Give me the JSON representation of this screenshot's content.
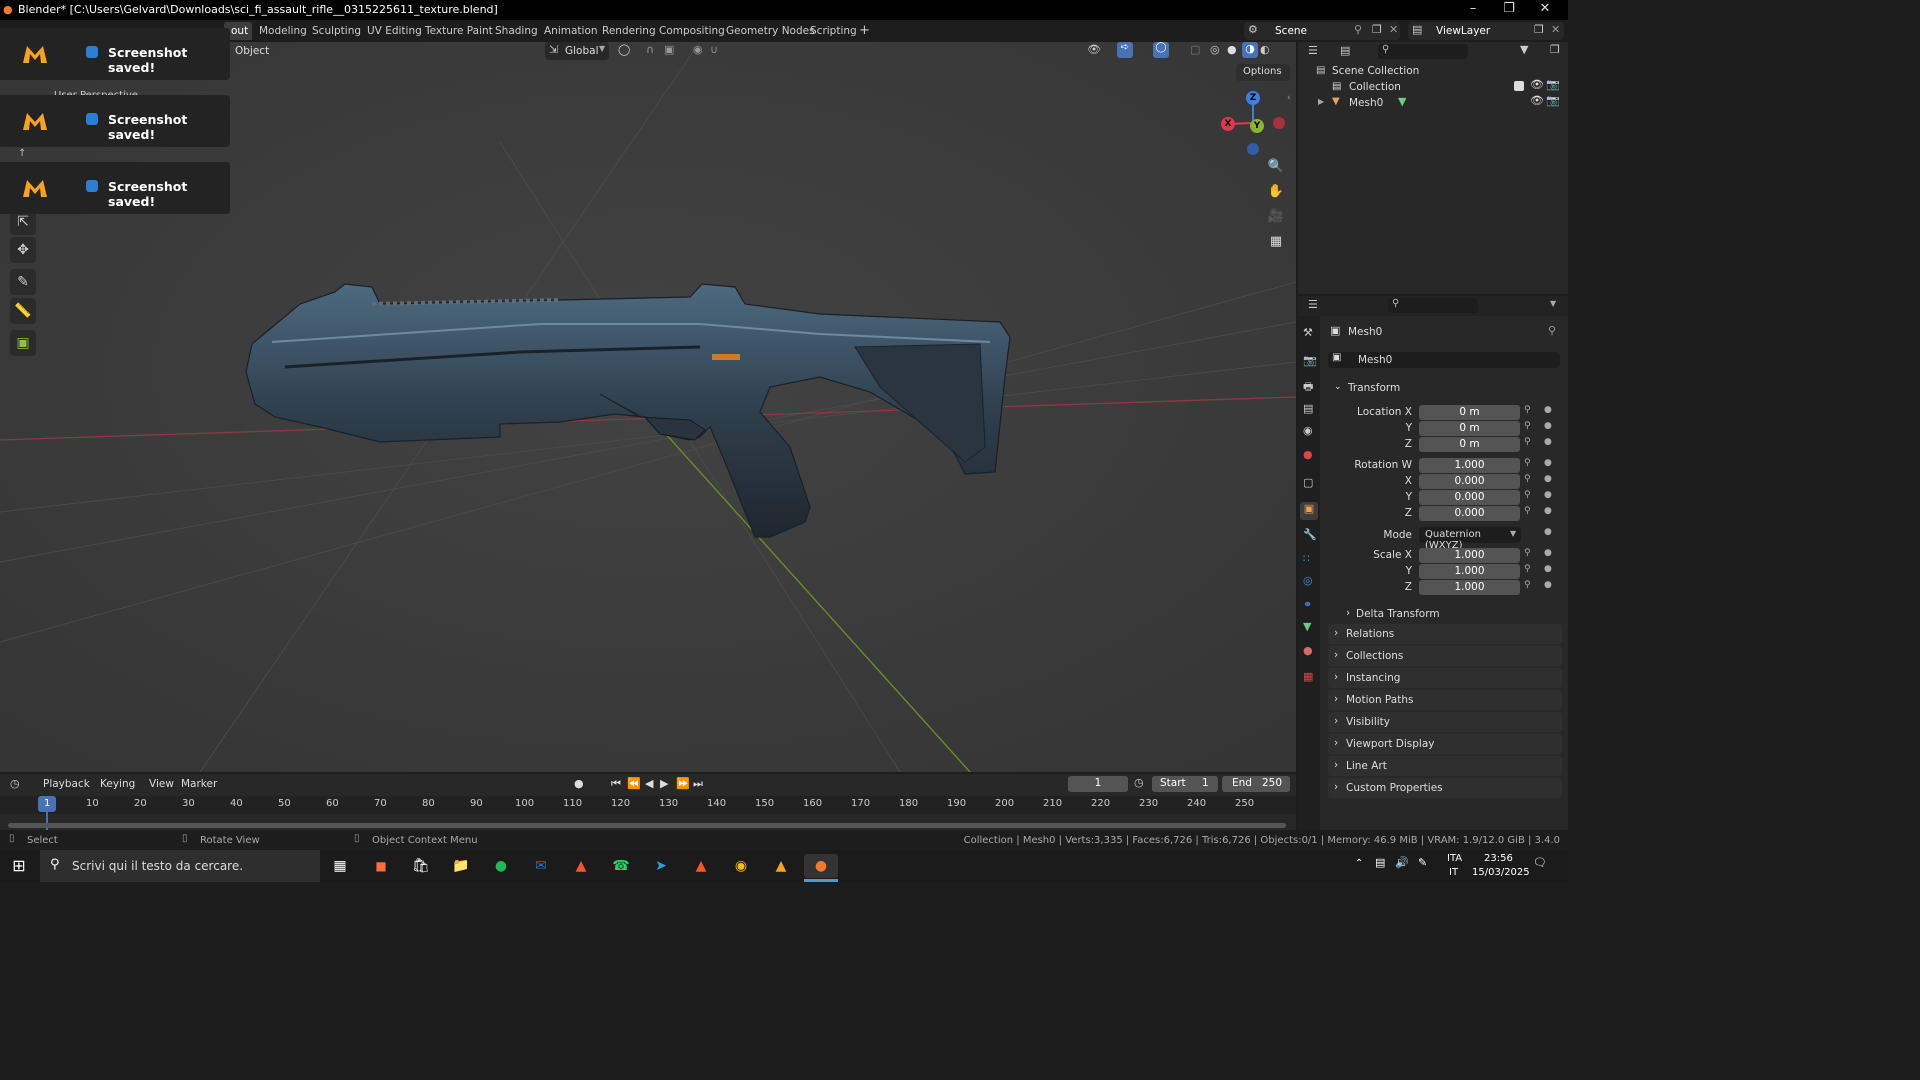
{
  "window": {
    "title": "Blender* [C:\\Users\\Gelvard\\Downloads\\sci_fi_assault_rifle__0315225611_texture.blend]",
    "min": "–",
    "max": "❐",
    "close": "✕"
  },
  "workspaces": [
    "out",
    "Modeling",
    "Sculpting",
    "UV Editing",
    "Texture Paint",
    "Shading",
    "Animation",
    "Rendering",
    "Compositing",
    "Geometry Nodes",
    "Scripting",
    "+"
  ],
  "scene": {
    "label": "Scene",
    "view_layer": "ViewLayer"
  },
  "viewport": {
    "mode_label": "Object",
    "transform_orientation": "Global",
    "options_label": "Options",
    "gizmo": {
      "z": "Z",
      "x": "X",
      "y": "Y"
    }
  },
  "toasts": [
    {
      "message": "Screenshot saved!"
    },
    {
      "message": "Screenshot saved!"
    },
    {
      "message": "Screenshot saved!"
    }
  ],
  "toast_hidden_text": "User Perspective",
  "outliner": {
    "root": "Scene Collection",
    "items": [
      {
        "label": "Collection"
      },
      {
        "label": "Mesh0"
      }
    ]
  },
  "properties": {
    "object_name": "Mesh0",
    "data_name": "Mesh0",
    "transform_title": "Transform",
    "location": {
      "label": "Location X",
      "x": "0 m",
      "y": "0 m",
      "z": "0 m"
    },
    "rotation": {
      "label": "Rotation W",
      "w": "1.000",
      "x": "0.000",
      "y": "0.000",
      "z": "0.000"
    },
    "axis": {
      "x": "X",
      "y": "Y",
      "z": "Z"
    },
    "mode": {
      "label": "Mode",
      "value": "Quaternion (WXYZ)"
    },
    "scale": {
      "label": "Scale X",
      "x": "1.000",
      "y": "1.000",
      "z": "1.000"
    },
    "delta": "Delta Transform",
    "sections": [
      "Relations",
      "Collections",
      "Instancing",
      "Motion Paths",
      "Visibility",
      "Viewport Display",
      "Line Art",
      "Custom Properties"
    ]
  },
  "timeline": {
    "menus": [
      "Playback",
      "Keying",
      "View",
      "Marker"
    ],
    "current_frame": "1",
    "start_label": "Start",
    "start": "1",
    "end_label": "End",
    "end": "250",
    "ticks": [
      "1",
      "10",
      "20",
      "30",
      "40",
      "50",
      "60",
      "70",
      "80",
      "90",
      "100",
      "110",
      "120",
      "130",
      "140",
      "150",
      "160",
      "170",
      "180",
      "190",
      "200",
      "210",
      "220",
      "230",
      "240",
      "250"
    ]
  },
  "status": {
    "left": [
      "Select",
      "Rotate View",
      "Object Context Menu"
    ],
    "right": "Collection | Mesh0 | Verts:3,335 | Faces:6,726 | Tris:6,726 | Objects:0/1 | Memory: 46.9 MiB | VRAM: 1.9/12.0 GiB | 3.4.0"
  },
  "taskbar": {
    "search_placeholder": "Scrivi qui il testo da cercare.",
    "lang_top": "ITA",
    "lang_bottom": "IT",
    "time": "23:56",
    "date": "15/03/2025"
  },
  "colors": {
    "accent": "#4772b3",
    "x_axis": "#e0384f",
    "y_axis": "#8bb52b",
    "z_axis": "#3b7fe0",
    "toast_logo": "#f7a31c"
  }
}
